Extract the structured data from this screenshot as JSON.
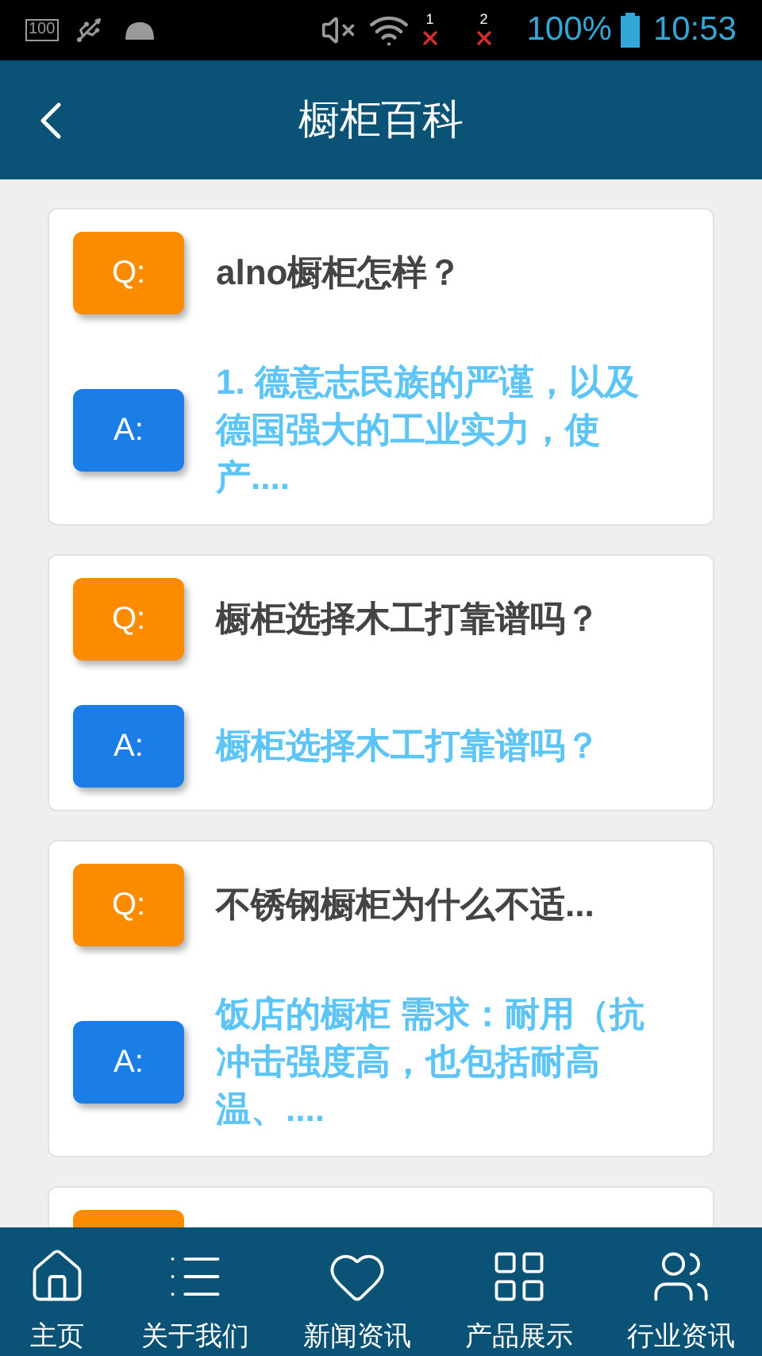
{
  "status_bar": {
    "box_label": "100",
    "sim_1": "1",
    "sim_2": "2",
    "battery": "100%",
    "time": "10:53"
  },
  "header": {
    "title": "橱柜百科"
  },
  "cards": [
    {
      "kind": "full",
      "q_label": "Q:",
      "question": "alno橱柜怎样？",
      "a_label": "A:",
      "answer": "1. 德意志民族的严谨，以及德国强大的工业实力，使产...."
    },
    {
      "kind": "full",
      "q_label": "Q:",
      "question": "橱柜选择木工打靠谱吗？",
      "a_label": "A:",
      "answer": "橱柜选择木工打靠谱吗？"
    },
    {
      "kind": "full",
      "q_label": "Q:",
      "question": "不锈钢橱柜为什么不适...",
      "a_label": "A:",
      "answer": "饭店的橱柜 需求：耐用（抗冲击强度高，也包括耐高温、...."
    },
    {
      "kind": "cut"
    }
  ],
  "nav": [
    {
      "label": "主页"
    },
    {
      "label": "关于我们"
    },
    {
      "label": "新闻资讯"
    },
    {
      "label": "产品展示"
    },
    {
      "label": "行业资讯"
    }
  ]
}
